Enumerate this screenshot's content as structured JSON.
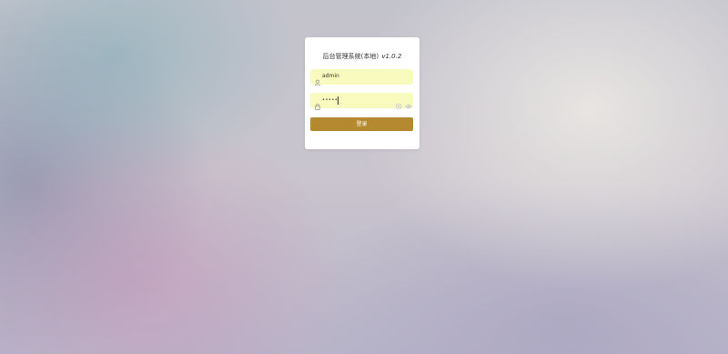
{
  "login": {
    "title": "后台管理系统(本地)",
    "version": "v1.0.2",
    "username": {
      "icon": "user-icon",
      "value": "admin"
    },
    "password": {
      "icon": "lock-icon",
      "value": "•••••",
      "clear_icon": "clear-icon",
      "toggle_icon": "eye-icon"
    },
    "submit_label": "登录",
    "colors": {
      "field_bg": "#f9fbbe",
      "button": "#b5892f"
    }
  }
}
